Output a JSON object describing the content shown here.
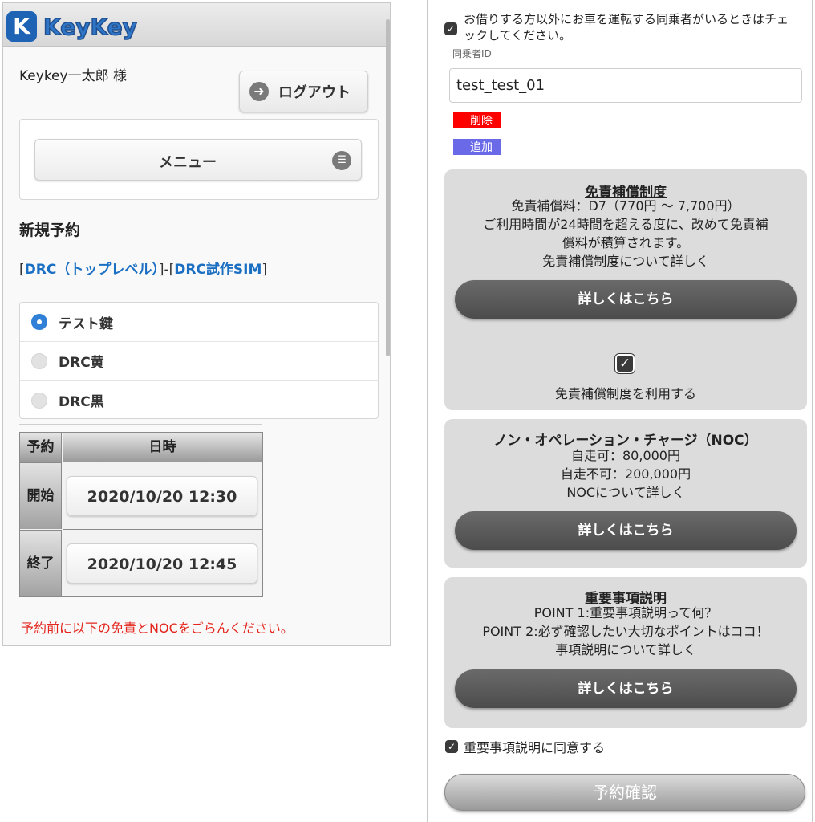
{
  "header": {
    "logo_mark": "K",
    "logo_text": "KeyKey"
  },
  "user": {
    "greeting": "Keykey一太郎 様"
  },
  "logout": {
    "label": "ログアウト",
    "icon": "arrow-right-circle-icon"
  },
  "menu": {
    "label": "メニュー",
    "icon": "list-icon"
  },
  "new_reservation": {
    "title": "新規予約",
    "breadcrumb": {
      "prefix": "[",
      "link1": "DRC（トップレベル）",
      "middle": "]-[",
      "link2": "DRC試作SIM",
      "suffix": "]"
    }
  },
  "keys": {
    "options": [
      {
        "label": "テスト鍵",
        "checked": true
      },
      {
        "label": "DRC黄",
        "checked": false
      },
      {
        "label": "DRC黒",
        "checked": false
      }
    ]
  },
  "schedule": {
    "headers": [
      "予約",
      "日時"
    ],
    "rows": [
      {
        "label": "開始",
        "value": "2020/10/20 12:30"
      },
      {
        "label": "終了",
        "value": "2020/10/20 12:45"
      }
    ]
  },
  "notice": "予約前に以下の免責とNOCをごらんください。",
  "companion": {
    "checkbox_text": "お借りする方以外にお車を運転する同乗者がいるときはチェックしてください。",
    "checked": true,
    "id_label": "同乗者ID",
    "id_value": "test_test_01",
    "delete_label": "削除",
    "add_label": "追加"
  },
  "insurance": {
    "title": "免責補償制度",
    "lines": [
      "免責補償料：D7（770円 〜 7,700円）",
      "ご利用時間が24時間を超える度に、改めて免責補",
      "償料が積算されます。",
      "免責補償制度について詳しく"
    ],
    "button": "詳しくはこちら",
    "use_label": "免責補償制度を利用する",
    "use_checked": true
  },
  "noc": {
    "title": "ノン・オペレーション・チャージ（NOC）",
    "lines": [
      "自走可：80,000円",
      "自走不可：200,000円",
      "NOCについて詳しく"
    ],
    "button": "詳しくはこちら"
  },
  "important": {
    "title": "重要事項説明",
    "lines": [
      "POINT 1:重要事項説明って何？",
      "POINT 2:必ず確認したい大切なポイントはココ！",
      "事項説明について詳しく"
    ],
    "button": "詳しくはこちら"
  },
  "agreement": {
    "label": "重要事項説明に同意する",
    "checked": true
  },
  "confirm": {
    "label": "予約確認"
  },
  "colors": {
    "brand": "#1f63b4",
    "link": "#1b6fc2",
    "notice": "#e3261d",
    "delete": "#ff0000",
    "add": "#6a6ae8"
  }
}
